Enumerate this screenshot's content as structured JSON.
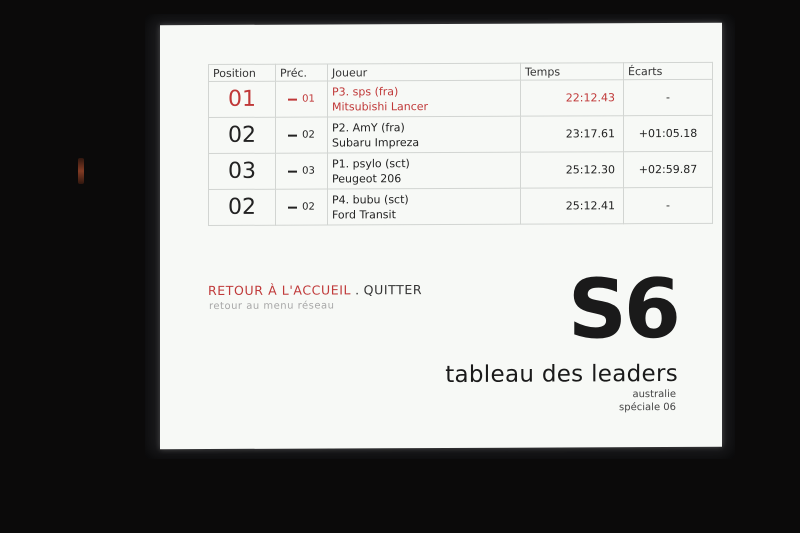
{
  "leaderboard": {
    "headers": {
      "position": "Position",
      "previous": "Préc.",
      "player": "Joueur",
      "time": "Temps",
      "gap": "Écarts"
    },
    "rows": [
      {
        "position": "01",
        "previous": "01",
        "player": "P3. sps (fra)",
        "car": "Mitsubishi Lancer",
        "time": "22:12.43",
        "gap": "-"
      },
      {
        "position": "02",
        "previous": "02",
        "player": "P2. AmY (fra)",
        "car": "Subaru Impreza",
        "time": "23:17.61",
        "gap": "+01:05.18"
      },
      {
        "position": "03",
        "previous": "03",
        "player": "P1. psylo (sct)",
        "car": "Peugeot 206",
        "time": "25:12.30",
        "gap": "+02:59.87"
      },
      {
        "position": "02",
        "previous": "02",
        "player": "P4. bubu (sct)",
        "car": "Ford Transit",
        "time": "25:12.41",
        "gap": "-"
      }
    ],
    "highlight_color": "#c03838"
  },
  "menu": {
    "home": "RETOUR À L'ACCUEIL",
    "separator": ".",
    "quit": "QUITTER",
    "sub": "retour au menu réseau"
  },
  "stage": {
    "code": "S6",
    "title": "tableau des leaders",
    "country": "australie",
    "name": "spéciale 06"
  }
}
